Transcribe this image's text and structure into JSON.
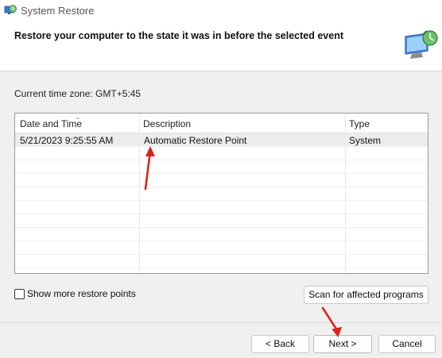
{
  "window": {
    "title": "System Restore",
    "icon": "system-restore-icon"
  },
  "header": {
    "heading": "Restore your computer to the state it was in before the selected event",
    "icon": "restore-monitor-icon"
  },
  "timezone_label": "Current time zone: GMT+5:45",
  "table": {
    "columns": [
      "Date and Time",
      "Description",
      "Type"
    ],
    "rows": [
      {
        "date": "5/21/2023 9:25:55 AM",
        "description": "Automatic Restore Point",
        "type": "System"
      }
    ]
  },
  "checkbox": {
    "label": "Show more restore points",
    "checked": false
  },
  "buttons": {
    "scan": "Scan for affected programs",
    "back": "< Back",
    "next": "Next >",
    "cancel": "Cancel"
  },
  "colors": {
    "annotation_arrow": "#d9261c",
    "window_bg": "#f0f0f0",
    "selected_row": "#ececec"
  }
}
